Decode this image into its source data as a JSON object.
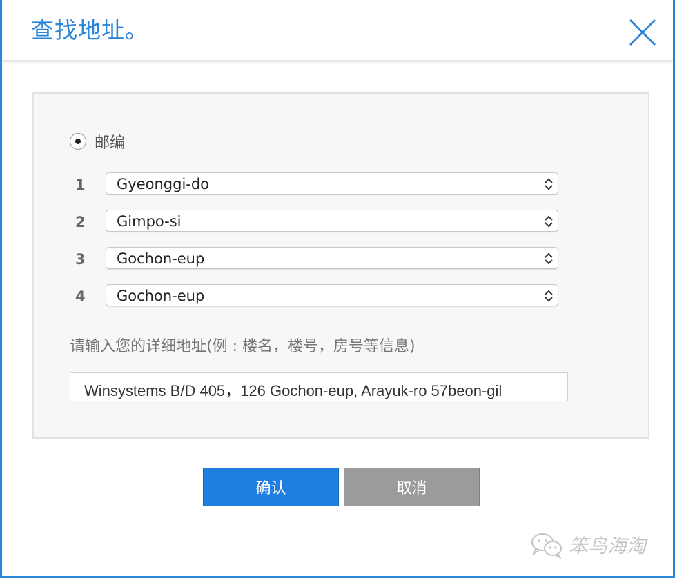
{
  "dialog": {
    "title": "查找地址。",
    "close_icon": "close-x-icon"
  },
  "form": {
    "radio_label": "邮编",
    "radio_checked": true,
    "rows": [
      {
        "num": "1",
        "value": "Gyeonggi-do"
      },
      {
        "num": "2",
        "value": "Gimpo-si"
      },
      {
        "num": "3",
        "value": "Gochon-eup"
      },
      {
        "num": "4",
        "value": "Gochon-eup"
      }
    ],
    "detail_label": "请输入您的详细地址(例 : 楼名，楼号，房号等信息)",
    "detail_value": "Winsystems B/D 405，126 Gochon-eup, Arayuk-ro 57beon-gil"
  },
  "buttons": {
    "confirm": "确认",
    "cancel": "取消"
  },
  "watermark": {
    "text": "笨鸟海淘",
    "icon": "wechat-icon"
  },
  "colors": {
    "accent": "#2b86d9",
    "confirm": "#1e7fe1",
    "cancel": "#9b9b9b"
  }
}
